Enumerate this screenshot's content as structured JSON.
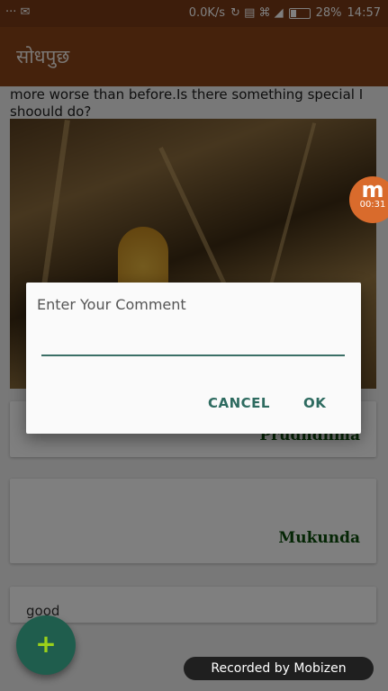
{
  "statusbar": {
    "left_icons": "··· ✉",
    "net_speed": "0.0K/s",
    "icons": "↻ ▤ ⌘ ◢",
    "battery": "28%",
    "time": "14:57"
  },
  "appbar": {
    "title": "सोधपुछ"
  },
  "post": {
    "text": "more worse than before.Is there something special I shoould do?"
  },
  "comments": [
    {
      "author": "Prudhdhma",
      "text": ""
    },
    {
      "author": "Mukunda",
      "text": ""
    },
    {
      "author": "",
      "text": "good"
    }
  ],
  "dialog": {
    "title": "Enter Your Comment",
    "input_value": "",
    "input_placeholder": "",
    "cancel_label": "CANCEL",
    "ok_label": "OK"
  },
  "fab": {
    "label": "+"
  },
  "recording": {
    "bubble_letter": "m",
    "bubble_time": "00:31",
    "banner": "Recorded by Mobizen"
  }
}
